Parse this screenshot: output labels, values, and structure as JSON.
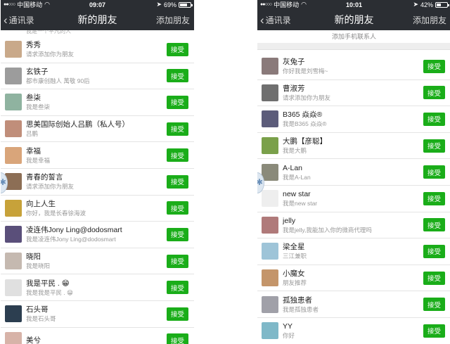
{
  "left": {
    "status": {
      "carrier": "中国移动",
      "time": "09:07",
      "battery": "69%",
      "battery_level": 0.69
    },
    "nav": {
      "back": "通讯录",
      "title": "新的朋友",
      "action": "添加朋友"
    },
    "partial_top": "我是一个平凡的人",
    "accept_label": "接受",
    "rows": [
      {
        "name": "秀秀",
        "sub": "请求添加你为朋友",
        "avatar_color": "#c9a98a"
      },
      {
        "name": "玄铁子",
        "sub": "都市康创融人 萬敬 90后",
        "avatar_color": "#9c9c9c"
      },
      {
        "name": "叁柒",
        "sub": "我是叁柒",
        "avatar_color": "#8fb3a0"
      },
      {
        "name": "思美国际创始人吕鹏（私人号）",
        "sub": "吕鹏",
        "avatar_color": "#c08e7a"
      },
      {
        "name": "幸福",
        "sub": "我是幸福",
        "avatar_color": "#d9a57a"
      },
      {
        "name": "青春的誓言",
        "sub": "请求添加你为朋友",
        "avatar_color": "#8c6e55"
      },
      {
        "name": "向上人生",
        "sub": "你好，我是长春徐海波",
        "avatar_color": "#c7a23a"
      },
      {
        "name": "凌连伟Jony Ling@dodosmart",
        "sub": "我是凌连伟Jony Ling@dodosmart",
        "avatar_color": "#5a4f7a"
      },
      {
        "name": "晓阳",
        "sub": "我是晓阳",
        "avatar_color": "#c5b9b0"
      },
      {
        "name": "我是平民 . 😁",
        "sub": "我是我是平民 . 😁",
        "avatar_color": "#e0e0e0"
      },
      {
        "name": "石头哥",
        "sub": "我是石头哥",
        "avatar_color": "#2c3e50"
      },
      {
        "name": "美兮",
        "sub": "",
        "avatar_color": "#d7b3a8"
      }
    ]
  },
  "right": {
    "status": {
      "carrier": "中国移动",
      "time": "10:01",
      "battery": "42%",
      "battery_level": 0.42
    },
    "nav": {
      "back": "通讯录",
      "title": "新的朋友",
      "action": "添加朋友"
    },
    "add_phone": "添加手机联系人",
    "accept_label": "接受",
    "rows": [
      {
        "name": "灰兔子",
        "sub": "你好我是刘雪梅~",
        "avatar_color": "#8a7a7a"
      },
      {
        "name": "曹淑芳",
        "sub": "请求添加你为朋友",
        "avatar_color": "#6f6f6f"
      },
      {
        "name": "B365 焱焱®",
        "sub": "我是B365 焱焱®",
        "avatar_color": "#5c5c7a"
      },
      {
        "name": "大鹏【彦聪】",
        "sub": "我是大鹏",
        "avatar_color": "#7aa04a"
      },
      {
        "name": "A-Lan",
        "sub": "我是A-Lan",
        "avatar_color": "#8a8a7a"
      },
      {
        "name": "new star",
        "sub": "我是new star",
        "avatar_color": "#eeeeee"
      },
      {
        "name": "jelly",
        "sub": "我是jelly,我能加入你的微商代理吗",
        "avatar_color": "#b07a7a"
      },
      {
        "name": "梁全星",
        "sub": "三江兼职",
        "avatar_color": "#9ec4d8"
      },
      {
        "name": "小魔女",
        "sub": "朋友推荐",
        "avatar_color": "#c4956a"
      },
      {
        "name": "孤独患者",
        "sub": "我是孤独患者",
        "avatar_color": "#a0a0a8"
      },
      {
        "name": "YY",
        "sub": "你好",
        "avatar_color": "#7fb8c8"
      }
    ]
  }
}
